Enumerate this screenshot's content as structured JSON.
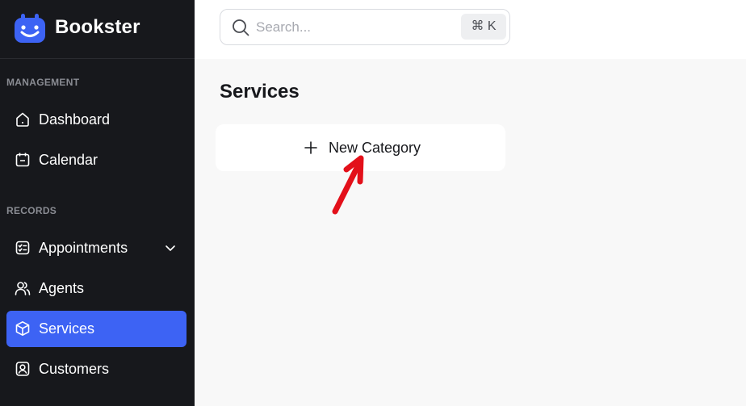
{
  "brand": {
    "name": "Bookster"
  },
  "sidebar": {
    "sections": [
      {
        "label": "MANAGEMENT"
      },
      {
        "label": "RECORDS"
      }
    ],
    "items": [
      {
        "label": "Dashboard",
        "icon": "home-icon"
      },
      {
        "label": "Calendar",
        "icon": "calendar-icon"
      },
      {
        "label": "Appointments",
        "icon": "checklist-icon"
      },
      {
        "label": "Agents",
        "icon": "users-icon"
      },
      {
        "label": "Services",
        "icon": "box-icon",
        "active": true
      },
      {
        "label": "Customers",
        "icon": "contact-icon"
      }
    ]
  },
  "search": {
    "placeholder": "Search...",
    "shortcut": "⌘ K"
  },
  "main": {
    "title": "Services",
    "new_category_label": "New Category"
  },
  "colors": {
    "sidebar_bg": "#17181c",
    "accent": "#3d63f4",
    "annotation_arrow": "#e3101a"
  }
}
